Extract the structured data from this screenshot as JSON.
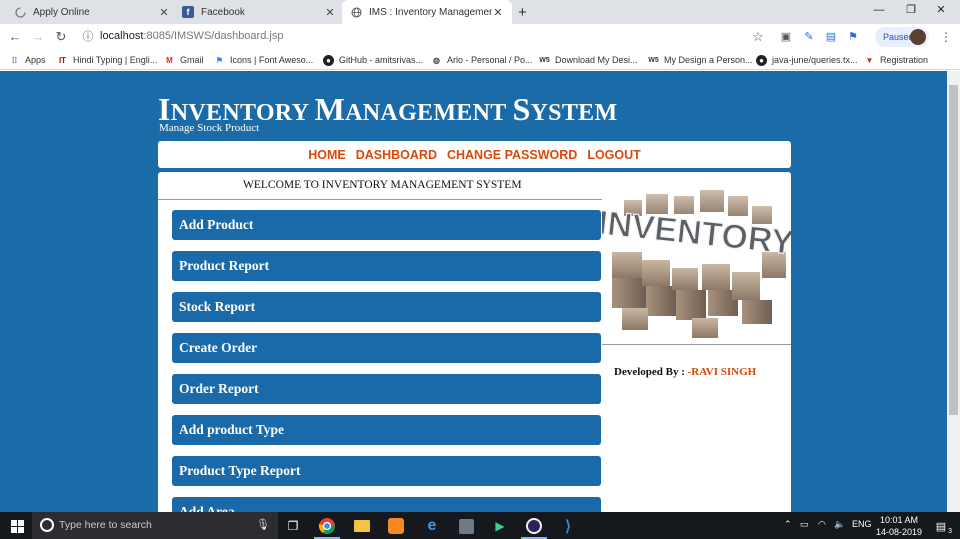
{
  "browser": {
    "tabs": [
      {
        "title": "Apply Online"
      },
      {
        "title": "Facebook"
      },
      {
        "title": "IMS : Inventory Management Sys"
      }
    ],
    "url": {
      "host": "localhost",
      "path": ":8085/IMSWS/dashboard.jsp"
    },
    "profile_status": "Paused",
    "bookmarks": [
      {
        "label": "Apps"
      },
      {
        "label": "Hindi Typing | Engli..."
      },
      {
        "label": "Gmail"
      },
      {
        "label": "Icons | Font Aweso..."
      },
      {
        "label": "GitHub - amitsrivas..."
      },
      {
        "label": "Arlo - Personal / Po..."
      },
      {
        "label": "Download My Desi..."
      },
      {
        "label": "My Design a Person..."
      },
      {
        "label": "java-june/queries.tx..."
      },
      {
        "label": "Registration"
      }
    ]
  },
  "site": {
    "brand": {
      "w1_cap": "I",
      "w1_rest": "NVENTORY",
      "w2_cap": "M",
      "w2_rest": "ANAGEMENT",
      "w3_cap": "S",
      "w3_rest": "YSTEM"
    },
    "subtitle": "Manage Stock Product",
    "menu": [
      "HOME",
      "DASHBOARD",
      "CHANGE PASSWORD",
      "LOGOUT"
    ],
    "welcome": "WELCOME TO INVENTORY MANAGEMENT SYSTEM",
    "dashboard_buttons": [
      "Add Product",
      "Product Report",
      "Stock Report",
      "Create Order",
      "Order Report",
      "Add product Type",
      "Product Type Report",
      "Add Area"
    ],
    "image_word": "INVENTORY",
    "developer": {
      "prefix": "Developed By : ",
      "name": "-RAVI SINGH"
    }
  },
  "taskbar": {
    "search_placeholder": "Type here to search",
    "language": "ENG",
    "time": "10:01 AM",
    "date": "14-08-2019",
    "notification_count": "3"
  },
  "colors": {
    "page_bg": "#1b6ba8",
    "button_bg": "#1a69a9",
    "menu_text": "#d84a0b"
  }
}
